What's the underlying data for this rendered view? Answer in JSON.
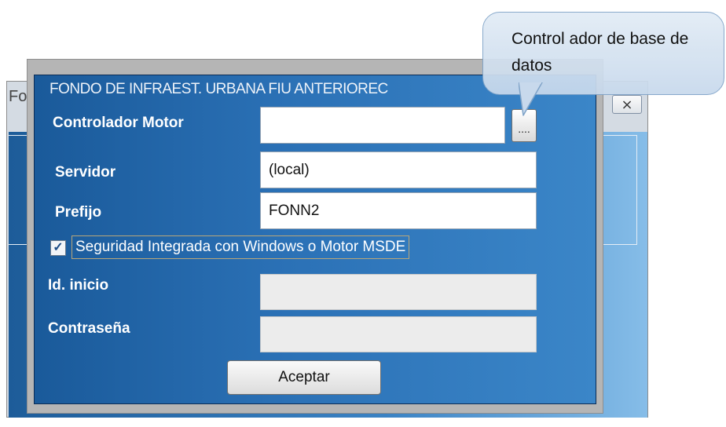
{
  "background_window": {
    "title_fragment": "Fo",
    "close_glyph": "⨯"
  },
  "dialog": {
    "title": "FONDO DE INFRAEST. URBANA FIU ANTERIOREC",
    "fields": {
      "controlador_motor": {
        "label": "Controlador Motor",
        "value": ""
      },
      "servidor": {
        "label": "Servidor",
        "value": "(local)"
      },
      "prefijo": {
        "label": "Prefijo",
        "value": "FONN2"
      },
      "id_inicio": {
        "label": "Id. inicio",
        "value": ""
      },
      "contrasena": {
        "label": "Contraseña",
        "value": ""
      }
    },
    "browse_label": "....",
    "checkbox": {
      "label": "Seguridad Integrada con Windows o Motor MSDE",
      "checked": true,
      "mark": "✓"
    },
    "accept_label": "Aceptar"
  },
  "callout": {
    "text": "Control ador de base de datos"
  },
  "colors": {
    "dialog_blue": "#2b71b6",
    "callout_fill": "#d4e2f1"
  }
}
